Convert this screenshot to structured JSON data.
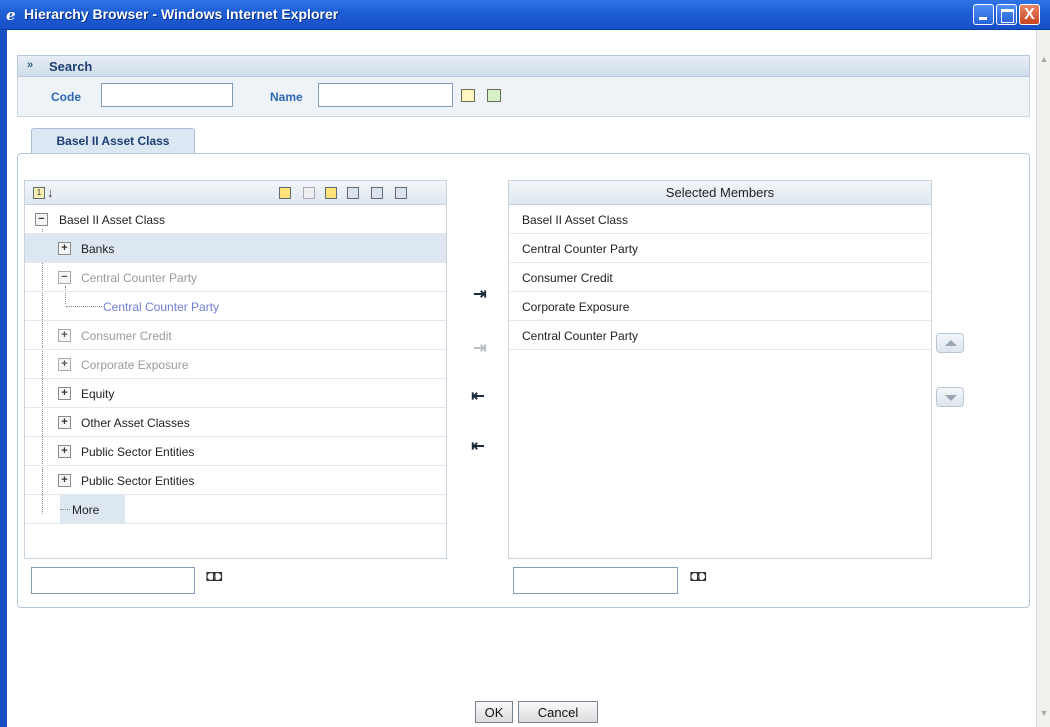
{
  "window": {
    "title": "Hierarchy Browser - Windows Internet Explorer",
    "close_glyph": "X"
  },
  "search": {
    "header_label": "Search",
    "code_label": "Code",
    "code_value": "",
    "name_label": "Name",
    "name_value": ""
  },
  "tabs": [
    {
      "label": "Basel II Asset Class",
      "active": true
    }
  ],
  "tree": {
    "toolbar_sort_icon": "1",
    "rows": [
      {
        "label": "Basel II Asset Class",
        "toggle": "−",
        "state": "expanded"
      },
      {
        "label": "Banks",
        "toggle": "+",
        "state": "collapsed",
        "selected": true
      },
      {
        "label": "Central Counter Party",
        "toggle": "−",
        "state": "expanded",
        "dim": true
      },
      {
        "label": "Central Counter Party",
        "toggle": "",
        "state": "leaf",
        "link": true
      },
      {
        "label": "Consumer Credit",
        "toggle": "+",
        "state": "collapsed",
        "dim": true
      },
      {
        "label": "Corporate Exposure",
        "toggle": "+",
        "state": "collapsed",
        "dim": true
      },
      {
        "label": "Equity",
        "toggle": "+",
        "state": "collapsed"
      },
      {
        "label": "Other Asset Classes",
        "toggle": "+",
        "state": "collapsed"
      },
      {
        "label": "Public Sector Entities",
        "toggle": "+",
        "state": "collapsed"
      },
      {
        "label": "Public Sector Entities",
        "toggle": "+",
        "state": "collapsed"
      },
      {
        "label": "More",
        "toggle": "",
        "state": "leaf"
      }
    ],
    "search_value": ""
  },
  "selected_members": {
    "header": "Selected Members",
    "items": [
      "Basel II Asset Class",
      "Central Counter Party",
      "Consumer Credit",
      "Corporate Exposure",
      "Central Counter Party"
    ],
    "search_value": ""
  },
  "move_buttons": {
    "add_glyph": "⇥",
    "add_all_glyph": "⇥",
    "remove_glyph": "⇤",
    "remove_all_glyph": "⇤"
  },
  "footer": {
    "ok_label": "OK",
    "cancel_label": "Cancel"
  },
  "colors": {
    "titlebar": "#1f5fd6",
    "label_blue": "#2d67b3",
    "tab_text": "#1d3f72",
    "link_text": "#6e7fd6"
  }
}
